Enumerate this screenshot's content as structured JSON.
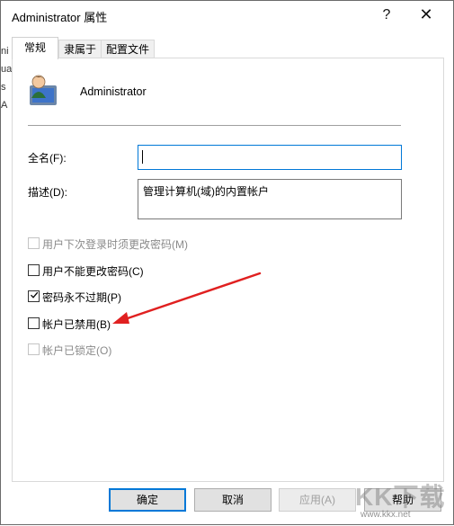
{
  "window": {
    "title": "Administrator 属性",
    "help_glyph": "?",
    "close_glyph": "✕"
  },
  "background_sliver": [
    "ni",
    "ua",
    "s",
    "A"
  ],
  "tabs": [
    {
      "label": "常规",
      "active": true
    },
    {
      "label": "隶属于",
      "active": false
    },
    {
      "label": "配置文件",
      "active": false
    }
  ],
  "user": {
    "name": "Administrator",
    "icon": "user-icon"
  },
  "fields": {
    "fullname_label": "全名(F):",
    "fullname_value": "",
    "description_label": "描述(D):",
    "description_value": "管理计算机(域)的内置帐户"
  },
  "checkboxes": [
    {
      "label": "用户下次登录时须更改密码(M)",
      "checked": false,
      "enabled": false
    },
    {
      "label": "用户不能更改密码(C)",
      "checked": false,
      "enabled": true
    },
    {
      "label": "密码永不过期(P)",
      "checked": true,
      "enabled": true
    },
    {
      "label": "帐户已禁用(B)",
      "checked": false,
      "enabled": true
    },
    {
      "label": "帐户已锁定(O)",
      "checked": false,
      "enabled": false
    }
  ],
  "buttons": {
    "ok": "确定",
    "cancel": "取消",
    "apply": "应用(A)",
    "help": "帮助"
  },
  "watermark": {
    "logo": "KK下载",
    "url": "www.kkx.net"
  },
  "colors": {
    "accent": "#0078d7",
    "arrow": "#e02020"
  }
}
